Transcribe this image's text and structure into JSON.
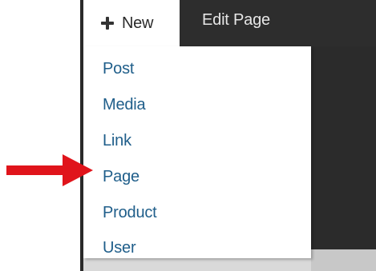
{
  "admin_bar": {
    "new_label": "New",
    "edit_page_label": "Edit Page"
  },
  "new_menu": {
    "items": [
      {
        "label": "Post"
      },
      {
        "label": "Media"
      },
      {
        "label": "Link"
      },
      {
        "label": "Page"
      },
      {
        "label": "Product"
      },
      {
        "label": "User"
      }
    ]
  },
  "colors": {
    "admin_bar_bg": "#2d2d2d",
    "menu_link": "#1f5e8a",
    "arrow": "#e0141b"
  },
  "icons": {
    "new": "plus-icon",
    "pointer": "red-arrow-icon"
  }
}
